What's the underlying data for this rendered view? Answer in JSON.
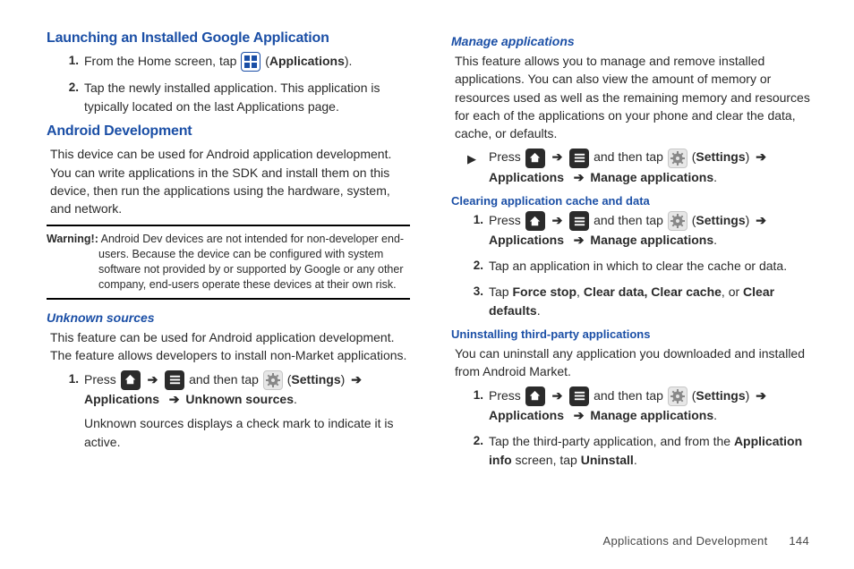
{
  "left": {
    "h_launch": "Launching an Installed Google Application",
    "launch": {
      "step1_a": "From the Home screen, tap ",
      "step1_b_open": " (",
      "step1_b_label": "Applications",
      "step1_b_close": ").",
      "step2": "Tap the newly installed application. This application is typically located on the last Applications page."
    },
    "h_android": "Android Development",
    "android_body": "This device can be used for Android application development. You can write applications in the SDK and install them on this device, then run the applications using the hardware, system, and network.",
    "warning_lead": "Warning!:",
    "warning_first": " Android Dev devices are not intended for non-developer end-",
    "warning_cont1": "users. Because the device can be configured with system",
    "warning_cont2": "software not provided by or supported by Google or any other",
    "warning_cont3": "company, end-users operate these devices at their own risk.",
    "h_unknown": "Unknown sources",
    "unknown_body": "This feature can be used for Android application development. The feature allows developers to install non-Market applications.",
    "unknown_step1_press": "Press ",
    "unknown_step1_then": " and then tap ",
    "settings_open": " (",
    "settings_label": "Settings",
    "settings_close": ") ",
    "apps_label": "Applications",
    "unknown_step1_last": "Unknown sources",
    "period": ".",
    "arrow": "➔",
    "unknown_step1_b": "Unknown sources displays a check mark to indicate it is active."
  },
  "right": {
    "h_manage": "Manage applications",
    "manage_body": "This feature allows you to manage and remove installed applications. You can also view the amount of memory or resources used as well as the remaining memory and resources for each of the applications on your phone and clear the data, cache, or defaults.",
    "press": "Press ",
    "then_tap": " and then tap ",
    "settings_open": " (",
    "settings_label": "Settings",
    "settings_close": ") ",
    "arrow": "➔",
    "apps_label": "Applications",
    "manage_apps_label": "Manage applications",
    "period": ".",
    "h_clear": "Clearing application cache and data",
    "clear_step2": "Tap an application in which to clear the cache or data.",
    "clear_step3_a": "Tap ",
    "clear_step3_b1": "Force stop",
    "clear_step3_c1": ", ",
    "clear_step3_b2": "Clear data, Clear cache",
    "clear_step3_c2": ", or ",
    "clear_step3_b3": "Clear defaults",
    "h_uninstall": "Uninstalling third-party applications",
    "uninstall_body": "You can uninstall any application you downloaded and installed from Android Market.",
    "uninstall_step2_a": "Tap the third-party application, and from the ",
    "uninstall_step2_b1": "Application info",
    "uninstall_step2_c": " screen, tap ",
    "uninstall_step2_b2": "Uninstall"
  },
  "footer": {
    "section": "Applications and Development",
    "page": "144"
  }
}
